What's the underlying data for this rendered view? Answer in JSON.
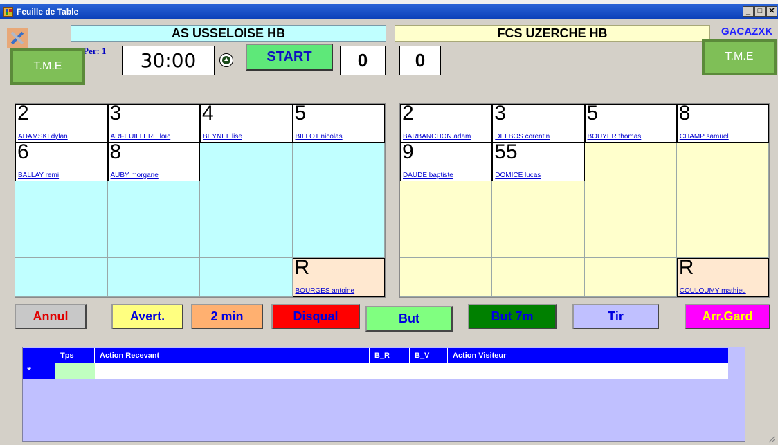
{
  "window": {
    "title": "Feuille de Table"
  },
  "header": {
    "home_team": "AS USSELOISE HB",
    "away_team": "FCS UZERCHE HB",
    "away_code": "GACAZXK",
    "period": "Per: 1",
    "clock": "30:00",
    "start_label": "START",
    "home_score": "0",
    "away_score": "0",
    "tme_label": "T.M.E"
  },
  "home_players": [
    {
      "num": "2",
      "name": "ADAMSKI dylan"
    },
    {
      "num": "3",
      "name": "ARFEUILLERE loïc"
    },
    {
      "num": "4",
      "name": "BEYNEL lise"
    },
    {
      "num": "5",
      "name": "BILLOT nicolas"
    },
    {
      "num": "6",
      "name": "BALLAY remi"
    },
    {
      "num": "8",
      "name": "AUBY morgane"
    },
    {
      "num": "R",
      "name": "BOURGES antoine"
    }
  ],
  "away_players": [
    {
      "num": "2",
      "name": "BARBANCHON adam"
    },
    {
      "num": "3",
      "name": "DELBOS corentin"
    },
    {
      "num": "5",
      "name": "BOUYER thomas"
    },
    {
      "num": "8",
      "name": "CHAMP samuel"
    },
    {
      "num": "9",
      "name": "DAUDE baptiste"
    },
    {
      "num": "55",
      "name": "DOMICE lucas"
    },
    {
      "num": "R",
      "name": "COULOUMY mathieu"
    }
  ],
  "actions": [
    {
      "label": "Annul",
      "bg": "#c8c8c8",
      "fg": "#e00000"
    },
    {
      "label": "Avert.",
      "bg": "#ffff80",
      "fg": "#0000e0"
    },
    {
      "label": "2 min",
      "bg": "#ffb070",
      "fg": "#0000e0"
    },
    {
      "label": "Disqual",
      "bg": "#ff0000",
      "fg": "#0000e0"
    },
    {
      "label": "But",
      "bg": "#80ff80",
      "fg": "#0000e0"
    },
    {
      "label": "But 7m",
      "bg": "#008000",
      "fg": "#0000e0"
    },
    {
      "label": "Tir",
      "bg": "#c0c0ff",
      "fg": "#0000e0"
    },
    {
      "label": "Arr.Gard",
      "bg": "#ff00ff",
      "fg": "#ffff00"
    }
  ],
  "log": {
    "columns": [
      "Tps",
      "Action Recevant",
      "B_R",
      "B_V",
      "Action Visiteur"
    ],
    "new_row_marker": "*"
  }
}
